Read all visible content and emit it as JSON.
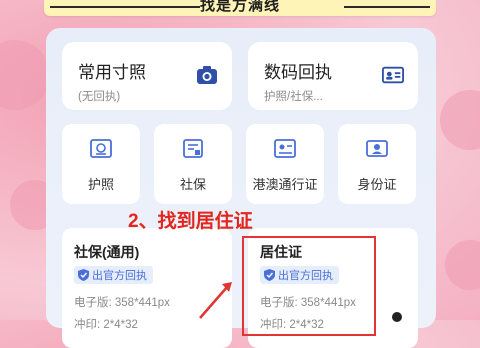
{
  "banner": {
    "text": "找是方满线"
  },
  "top_cards": [
    {
      "title": "常用寸照",
      "subtitle": "(无回执)",
      "icon": "camera-icon"
    },
    {
      "title": "数码回执",
      "subtitle": "护照/社保...",
      "icon": "id-card-icon"
    }
  ],
  "doc_types": [
    {
      "label": "护照",
      "icon": "passport-icon"
    },
    {
      "label": "社保",
      "icon": "social-security-icon"
    },
    {
      "label": "港澳通行证",
      "icon": "permit-icon"
    },
    {
      "label": "身份证",
      "icon": "identity-card-icon"
    }
  ],
  "list_items": [
    {
      "title": "社保(通用)",
      "badge": "出官方回执",
      "size": "电子版: 358*441px",
      "extra": "冲印: 2*4*32"
    },
    {
      "title": "居住证",
      "badge": "出官方回执",
      "size": "电子版: 358*441px",
      "extra": "冲印: 2*4*32"
    }
  ],
  "annotation": {
    "text": "2、找到居住证"
  },
  "colors": {
    "accent": "#4a6fd8",
    "highlight": "#e23434",
    "annotation": "#e2261d"
  }
}
